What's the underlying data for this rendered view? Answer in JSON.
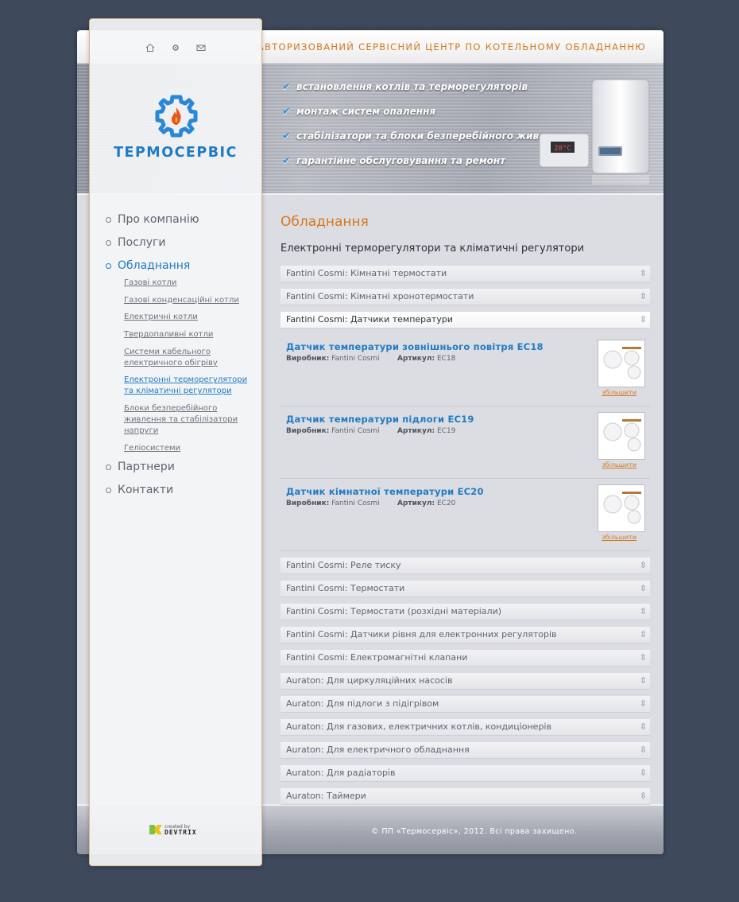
{
  "header": {
    "tagline": "АВТОРИЗОВАНИЙ СЕРВІСНИЙ ЦЕНТР ПО КОТЕЛЬНОМУ ОБЛАДНАННЮ",
    "icons": [
      "home-icon",
      "gear-icon",
      "mail-icon"
    ]
  },
  "logo": {
    "text": "ТЕРМОСЕРВІС"
  },
  "banner": {
    "features": [
      "встановлення котлів та терморегуляторів",
      "монтаж систем опалення",
      "стабілізатори та блоки безперебійного живлення",
      "гарантійне обслуговування та ремонт"
    ],
    "device_display": "28°C"
  },
  "nav": {
    "items": [
      {
        "label": "Про компанію"
      },
      {
        "label": "Послуги"
      },
      {
        "label": "Обладнання",
        "active": true
      },
      {
        "label": "Партнери"
      },
      {
        "label": "Контакти"
      }
    ],
    "subitems": [
      {
        "label": "Газові котли"
      },
      {
        "label": "Газові конденсаційні котли"
      },
      {
        "label": "Електричні котли"
      },
      {
        "label": "Твердопаливні котли"
      },
      {
        "label": "Системи кабельного електричного обігріву"
      },
      {
        "label": "Електронні терморегулятори та кліматичні регулятори",
        "active": true
      },
      {
        "label": "Блоки безперебійного живлення та стабілізатори напруги"
      },
      {
        "label": "Геліосистеми"
      }
    ]
  },
  "content": {
    "title": "Обладнання",
    "subtitle": "Електронні терморегулятори та кліматичні регулятори",
    "categories_before": [
      "Fantini Cosmi: Кімнатні термостати",
      "Fantini Cosmi: Кімнатні хронотермостати"
    ],
    "open_category": "Fantini Cosmi: Датчики температури",
    "maker_label": "Виробник:",
    "article_label": "Артикул:",
    "zoom_label": "збільшити",
    "products": [
      {
        "name": "Датчик температури зовнішнього повітря EC18",
        "maker": "Fantini Cosmi",
        "article": "EC18"
      },
      {
        "name": "Датчик температури підлоги EC19",
        "maker": "Fantini Cosmi",
        "article": "EC19"
      },
      {
        "name": "Датчик кімнатної температури EC20",
        "maker": "Fantini Cosmi",
        "article": "EC20"
      }
    ],
    "categories_after": [
      "Fantini Cosmi: Реле тиску",
      "Fantini Cosmi: Термостати",
      "Fantini Cosmi: Термостати (розхідні матеріали)",
      "Fantini Cosmi: Датчики рівня для електронних регуляторів",
      "Fantini Cosmi: Електромагнітні клапани",
      "Auraton: Для циркуляційних насосів",
      "Auraton: Для підлоги з підігрівом",
      "Auraton: Для газових, електричних котлів, кондиціонерів",
      "Auraton: Для електричного обладнання",
      "Auraton: Для радіаторів",
      "Auraton: Таймери"
    ],
    "expand_icon": "updown-arrows-icon"
  },
  "footer": {
    "copyright": "© ПП «Термосервіс», 2012. Всі права захищено.",
    "credit_small": "created by",
    "credit_brand": "DEVTRIX"
  },
  "colors": {
    "accent_orange": "#d4791e",
    "link_blue": "#1f7bc4",
    "background": "#3e4a5c"
  }
}
